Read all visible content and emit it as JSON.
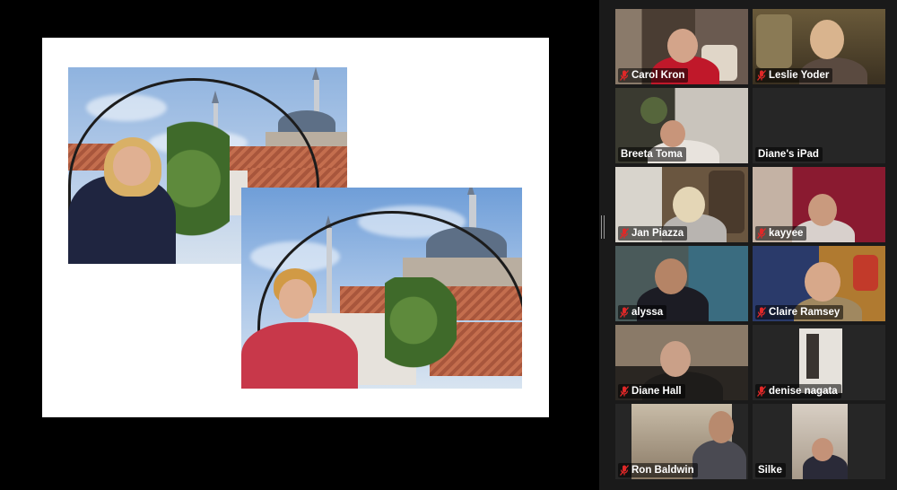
{
  "meeting": {
    "gallery": [
      {
        "name": "Carol Kron",
        "muted": true
      },
      {
        "name": "Leslie Yoder",
        "muted": true
      },
      {
        "name": "Breeta Toma",
        "muted": false
      },
      {
        "name": "Diane's iPad",
        "muted": false
      },
      {
        "name": "Jan Piazza",
        "muted": true
      },
      {
        "name": "kayyee",
        "muted": true
      },
      {
        "name": "alyssa",
        "muted": true
      },
      {
        "name": "Claire Ramsey",
        "muted": true
      },
      {
        "name": "Diane Hall",
        "muted": true
      },
      {
        "name": "denise nagata",
        "muted": true
      },
      {
        "name": "Ron Baldwin",
        "muted": true
      },
      {
        "name": "Silke",
        "muted": false
      }
    ],
    "icons": {
      "muted_mic": "muted-mic-icon",
      "divider": "gallery-resize-handle"
    },
    "colors": {
      "muted_icon": "#e02828",
      "label_text": "#ffffff",
      "background": "#1a1a1a"
    }
  }
}
